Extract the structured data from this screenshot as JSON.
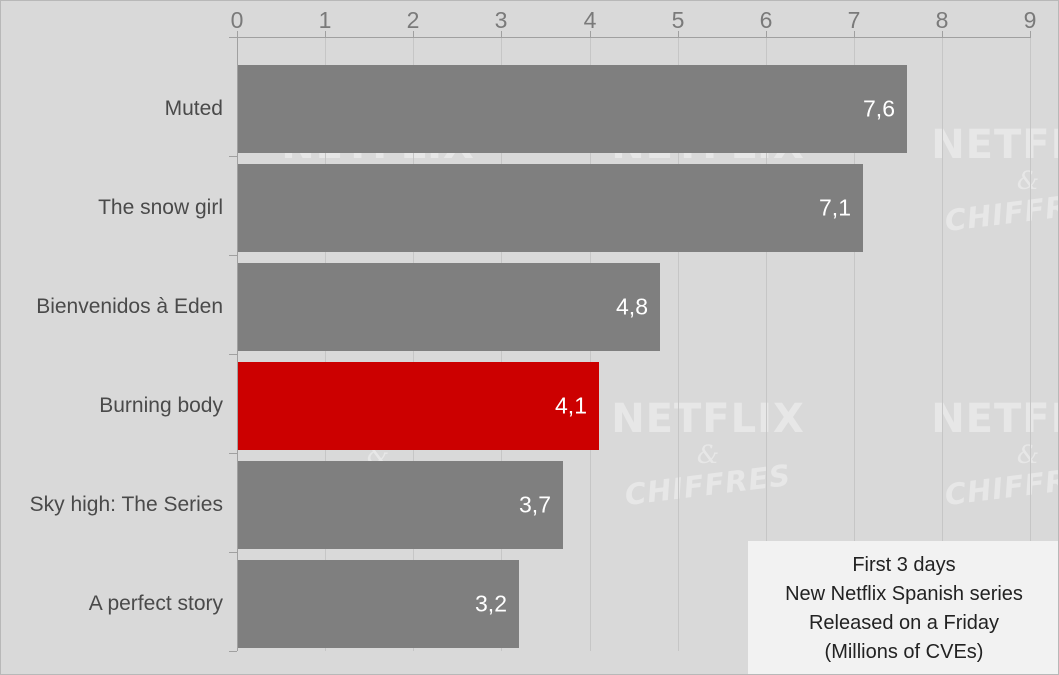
{
  "chart_data": {
    "type": "bar",
    "orientation": "horizontal",
    "title": "",
    "xlabel": "",
    "ylabel": "",
    "xlim": [
      0,
      9
    ],
    "xticks": [
      "0",
      "1",
      "2",
      "3",
      "4",
      "5",
      "6",
      "7",
      "8",
      "9"
    ],
    "grid": true,
    "categories": [
      "Muted",
      "The snow girl",
      "Bienvenidos à Eden",
      "Burning body",
      "Sky high: The Series",
      "A perfect story"
    ],
    "values": [
      7.6,
      7.1,
      4.8,
      4.1,
      3.7,
      3.2
    ],
    "value_labels": [
      "7,6",
      "7,1",
      "4,8",
      "4,1",
      "3,7",
      "3,2"
    ],
    "bar_colors": [
      "#7f7f7f",
      "#7f7f7f",
      "#7f7f7f",
      "#cc0000",
      "#7f7f7f",
      "#7f7f7f"
    ],
    "highlight_index": 3,
    "legend_position": "bottom-right",
    "annotations": [
      "First 3 days",
      "New Netflix Spanish series",
      "Released on a Friday",
      "(Millions of CVEs)"
    ]
  },
  "colors": {
    "background": "#d9d9d9",
    "bar_gray": "#7f7f7f",
    "bar_red": "#cc0000",
    "gridline": "#c6c6c6",
    "axis": "#a0a0a0",
    "tick_text": "#7a7a7a",
    "category_text": "#4a4a4a",
    "value_text": "#ffffff",
    "legend_background": "#f2f2f2",
    "legend_text": "#222222",
    "watermark": "#ffffff"
  },
  "legend": {
    "line1": "First 3 days",
    "line2": "New Netflix Spanish series",
    "line3": "Released on a Friday",
    "line4": "(Millions of CVEs)"
  },
  "watermark": {
    "main": "NETFLIX",
    "amp": "&",
    "sub": "CHIFFRES"
  },
  "axis": {
    "t0": "0",
    "t1": "1",
    "t2": "2",
    "t3": "3",
    "t4": "4",
    "t5": "5",
    "t6": "6",
    "t7": "7",
    "t8": "8",
    "t9": "9"
  },
  "bars": [
    {
      "label": "Muted",
      "value_label": "7,6"
    },
    {
      "label": "The snow girl",
      "value_label": "7,1"
    },
    {
      "label": "Bienvenidos à Eden",
      "value_label": "4,8"
    },
    {
      "label": "Burning body",
      "value_label": "4,1"
    },
    {
      "label": "Sky high: The Series",
      "value_label": "3,7"
    },
    {
      "label": "A perfect story",
      "value_label": "3,2"
    }
  ]
}
